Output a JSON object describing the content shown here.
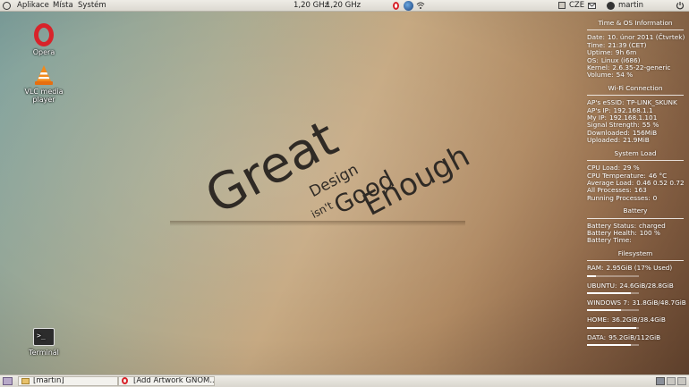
{
  "top_panel": {
    "menus": [
      "Aplikace",
      "Místa",
      "Systém"
    ],
    "cpu_freq": [
      "1,20 GHz",
      "1,20 GHz"
    ],
    "keyboard_layout": "CZE",
    "user": "martin"
  },
  "desktop_icons": [
    {
      "label": "Opera",
      "icon": "opera-icon"
    },
    {
      "label": "VLC media player",
      "icon": "vlc-icon"
    },
    {
      "label": "Terminál",
      "icon": "terminal-icon"
    }
  ],
  "wallpaper": {
    "words": [
      "Great",
      "Design",
      "isn't",
      "Good",
      "Enough"
    ]
  },
  "conky": {
    "time_os": {
      "title": "Time & OS Information",
      "rows": [
        {
          "label": "Date:",
          "value": "10. únor 2011 (Čtvrtek)"
        },
        {
          "label": "Time:",
          "value": "21:39 (CET)"
        },
        {
          "label": "Uptime:",
          "value": "9h 6m"
        },
        {
          "label": "OS:",
          "value": "Linux (i686)"
        },
        {
          "label": "Kernel:",
          "value": "2.6.35-22-generic"
        },
        {
          "label": "Volume:",
          "value": "54 %"
        }
      ]
    },
    "wifi": {
      "title": "Wi-Fi Connection",
      "rows": [
        {
          "label": "AP's eSSID:",
          "value": "TP-LINK_SKUNK"
        },
        {
          "label": "AP's IP:",
          "value": "192.168.1.1"
        },
        {
          "label": "My IP:",
          "value": "192.168.1.101"
        },
        {
          "label": "Signal Strength:",
          "value": "55  %"
        },
        {
          "label": "Downloaded:",
          "value": "156MiB"
        },
        {
          "label": "Uploaded:",
          "value": "21.9MiB"
        }
      ]
    },
    "system_load": {
      "title": "System Load",
      "rows": [
        {
          "label": "CPU Load:",
          "value": "29 %"
        },
        {
          "label": "CPU Temperature:",
          "value": "46 °C"
        },
        {
          "label": "Average Load:",
          "value": "0.46 0.52 0.72"
        },
        {
          "label": "All Processes:",
          "value": "163"
        },
        {
          "label": "Running Processes:",
          "value": "0"
        }
      ]
    },
    "battery": {
      "title": "Battery",
      "rows": [
        {
          "label": "Battery Status:",
          "value": "charged"
        },
        {
          "label": "Battery Health:",
          "value": "100 %"
        },
        {
          "label": "Battery Time:",
          "value": ""
        }
      ]
    },
    "filesystem": {
      "title": "Filesystem",
      "rows": [
        {
          "label": "RAM:",
          "value": "2.95GiB (17% Used)",
          "fill": 0.17
        },
        {
          "label": "UBUNTU:",
          "value": "24.6GiB/28.8GiB",
          "fill": 0.85
        },
        {
          "label": "WINDOWS 7:",
          "value": "31.8GiB/48.7GiB",
          "fill": 0.65
        },
        {
          "label": "HOME:",
          "value": "36.2GiB/38.4GiB",
          "fill": 0.94
        },
        {
          "label": "DATA:",
          "value": "95.2GiB/112GiB",
          "fill": 0.85
        }
      ]
    }
  },
  "taskbar": {
    "items": [
      {
        "label": "[martin]",
        "icon": "folder-icon"
      },
      {
        "label": "[Add Artwork GNOM...",
        "icon": "opera-icon"
      }
    ]
  },
  "colors": {
    "panel": "#e6e4dd",
    "opera_red": "#d8232a",
    "vlc_orange": "#f28a1c"
  }
}
